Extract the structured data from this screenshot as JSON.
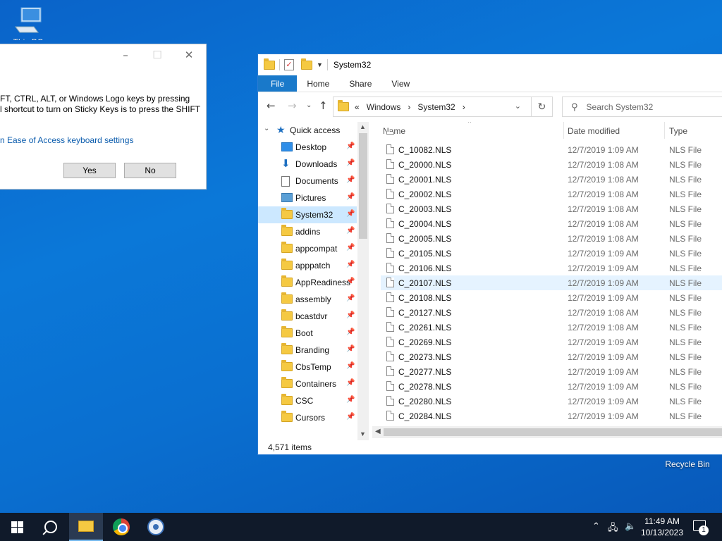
{
  "desktop": {
    "this_pc_label": "This PC",
    "recycle_label": "Recycle Bin"
  },
  "sticky_dialog": {
    "message": "FT, CTRL, ALT, or Windows Logo keys by pressing\nl shortcut to turn on Sticky Keys is to press the SHIFT",
    "link": "n Ease of Access keyboard settings",
    "yes_label": "Yes",
    "no_label": "No"
  },
  "explorer": {
    "title": "System32",
    "ribbon_tabs": [
      "File",
      "Home",
      "Share",
      "View"
    ],
    "address": {
      "prefix": "«",
      "crumbs": [
        "Windows",
        "System32"
      ]
    },
    "search_placeholder": "Search System32",
    "columns": {
      "name": "Name",
      "date": "Date modified",
      "type": "Type"
    },
    "nav": [
      {
        "label": "Quick access",
        "icon": "star-icon"
      },
      {
        "label": "Desktop",
        "icon": "desktop-icon"
      },
      {
        "label": "Downloads",
        "icon": "download-icon"
      },
      {
        "label": "Documents",
        "icon": "document-icon"
      },
      {
        "label": "Pictures",
        "icon": "pictures-icon"
      },
      {
        "label": "System32",
        "icon": "folder-icon"
      },
      {
        "label": "addins",
        "icon": "folder-icon"
      },
      {
        "label": "appcompat",
        "icon": "folder-icon"
      },
      {
        "label": "apppatch",
        "icon": "folder-icon"
      },
      {
        "label": "AppReadiness",
        "icon": "folder-icon"
      },
      {
        "label": "assembly",
        "icon": "folder-icon"
      },
      {
        "label": "bcastdvr",
        "icon": "folder-icon"
      },
      {
        "label": "Boot",
        "icon": "folder-icon"
      },
      {
        "label": "Branding",
        "icon": "folder-icon"
      },
      {
        "label": "CbsTemp",
        "icon": "folder-icon"
      },
      {
        "label": "Containers",
        "icon": "folder-icon"
      },
      {
        "label": "CSC",
        "icon": "folder-icon"
      },
      {
        "label": "Cursors",
        "icon": "folder-icon"
      }
    ],
    "files": [
      {
        "name": "C_10082.NLS",
        "date": "12/7/2019 1:09 AM",
        "type": "NLS File"
      },
      {
        "name": "C_20000.NLS",
        "date": "12/7/2019 1:08 AM",
        "type": "NLS File"
      },
      {
        "name": "C_20001.NLS",
        "date": "12/7/2019 1:08 AM",
        "type": "NLS File"
      },
      {
        "name": "C_20002.NLS",
        "date": "12/7/2019 1:08 AM",
        "type": "NLS File"
      },
      {
        "name": "C_20003.NLS",
        "date": "12/7/2019 1:08 AM",
        "type": "NLS File"
      },
      {
        "name": "C_20004.NLS",
        "date": "12/7/2019 1:08 AM",
        "type": "NLS File"
      },
      {
        "name": "C_20005.NLS",
        "date": "12/7/2019 1:08 AM",
        "type": "NLS File"
      },
      {
        "name": "C_20105.NLS",
        "date": "12/7/2019 1:09 AM",
        "type": "NLS File"
      },
      {
        "name": "C_20106.NLS",
        "date": "12/7/2019 1:09 AM",
        "type": "NLS File"
      },
      {
        "name": "C_20107.NLS",
        "date": "12/7/2019 1:09 AM",
        "type": "NLS File"
      },
      {
        "name": "C_20108.NLS",
        "date": "12/7/2019 1:09 AM",
        "type": "NLS File"
      },
      {
        "name": "C_20127.NLS",
        "date": "12/7/2019 1:08 AM",
        "type": "NLS File"
      },
      {
        "name": "C_20261.NLS",
        "date": "12/7/2019 1:08 AM",
        "type": "NLS File"
      },
      {
        "name": "C_20269.NLS",
        "date": "12/7/2019 1:09 AM",
        "type": "NLS File"
      },
      {
        "name": "C_20273.NLS",
        "date": "12/7/2019 1:09 AM",
        "type": "NLS File"
      },
      {
        "name": "C_20277.NLS",
        "date": "12/7/2019 1:09 AM",
        "type": "NLS File"
      },
      {
        "name": "C_20278.NLS",
        "date": "12/7/2019 1:09 AM",
        "type": "NLS File"
      },
      {
        "name": "C_20280.NLS",
        "date": "12/7/2019 1:09 AM",
        "type": "NLS File"
      },
      {
        "name": "C_20284.NLS",
        "date": "12/7/2019 1:09 AM",
        "type": "NLS File"
      }
    ],
    "status": "4,571 items"
  },
  "taskbar": {
    "time": "11:49 AM",
    "date": "10/13/2023",
    "notification_count": "1"
  }
}
